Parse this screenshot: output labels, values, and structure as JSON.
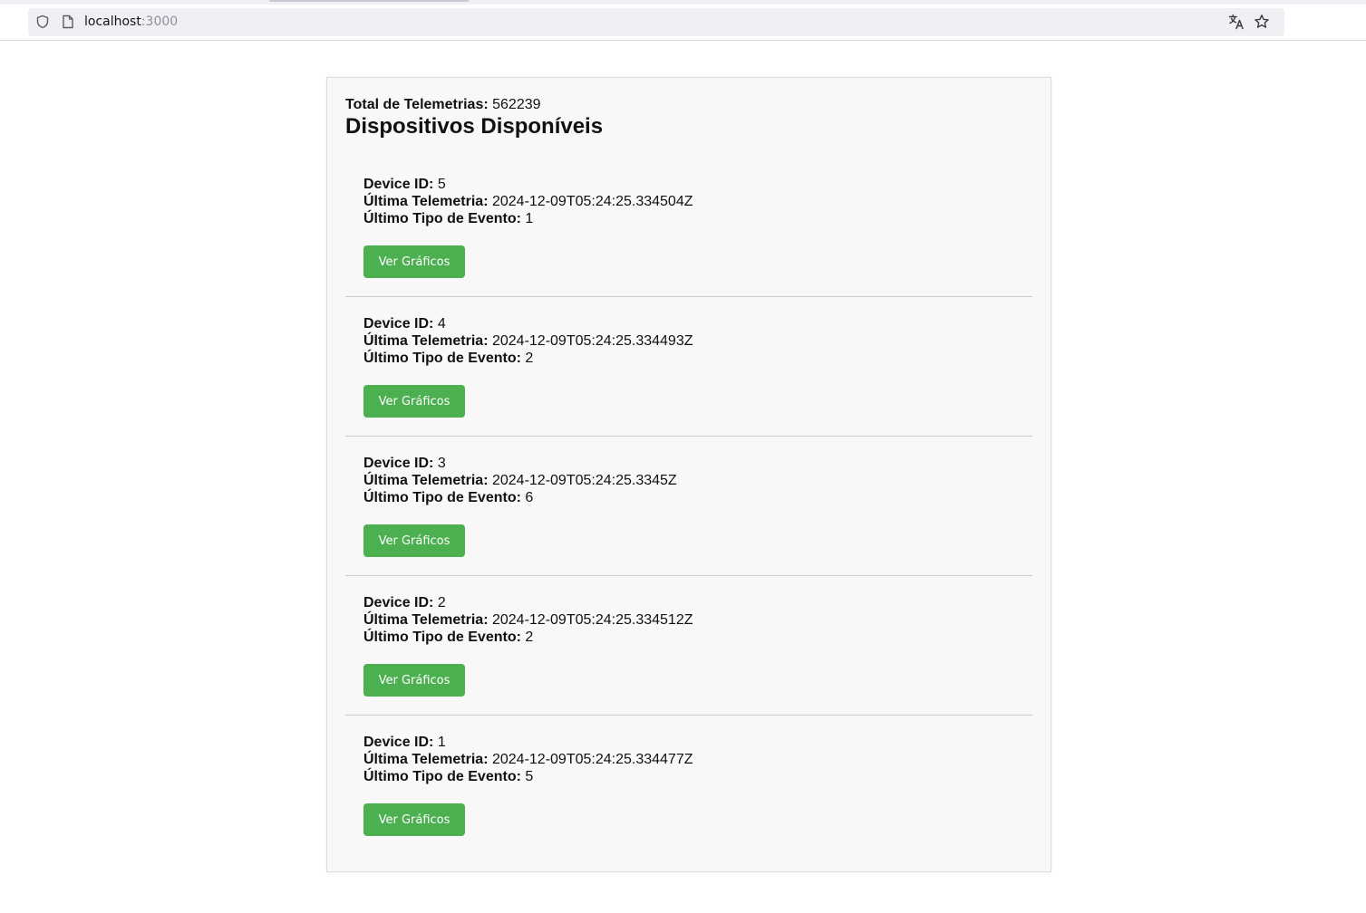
{
  "browser": {
    "url_host": "localhost",
    "url_port": ":3000"
  },
  "header": {
    "total_label": "Total de Telemetrias:",
    "total_value": "562239",
    "title": "Dispositivos Disponíveis"
  },
  "labels": {
    "device_id": "Device ID:",
    "last_telemetry": "Última Telemetria:",
    "last_event_type": "Último Tipo de Evento:",
    "button": "Ver Gráficos"
  },
  "devices": [
    {
      "id": "5",
      "last_telemetry": "2024-12-09T05:24:25.334504Z",
      "last_event_type": "1"
    },
    {
      "id": "4",
      "last_telemetry": "2024-12-09T05:24:25.334493Z",
      "last_event_type": "2"
    },
    {
      "id": "3",
      "last_telemetry": "2024-12-09T05:24:25.3345Z",
      "last_event_type": "6"
    },
    {
      "id": "2",
      "last_telemetry": "2024-12-09T05:24:25.334512Z",
      "last_event_type": "2"
    },
    {
      "id": "1",
      "last_telemetry": "2024-12-09T05:24:25.334477Z",
      "last_event_type": "5"
    }
  ],
  "colors": {
    "button": "#4caf50",
    "card_background": "#f8f8f8"
  }
}
